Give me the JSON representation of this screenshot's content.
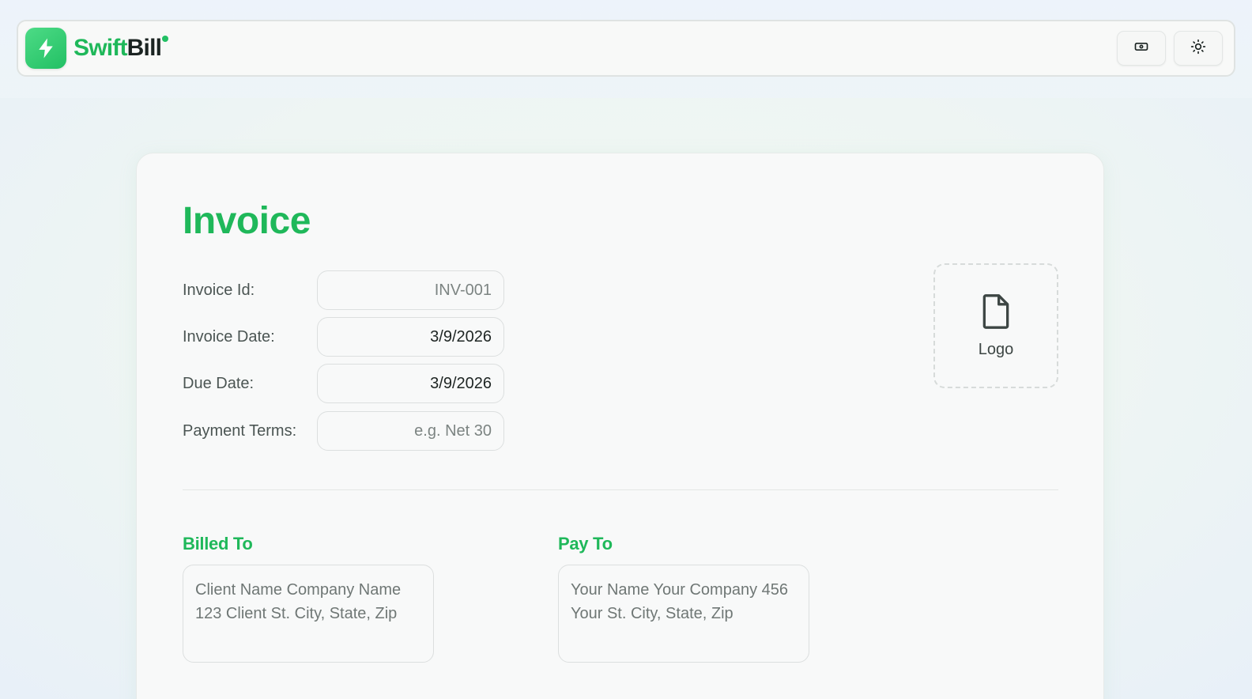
{
  "brand": {
    "name_part1": "Swift",
    "name_part2": "Bill"
  },
  "header": {
    "actions": [
      {
        "icon": "currency-icon"
      },
      {
        "icon": "sun-icon"
      }
    ]
  },
  "invoice": {
    "title": "Invoice",
    "fields": {
      "id": {
        "label": "Invoice Id:",
        "value": "",
        "placeholder": "INV-001"
      },
      "date": {
        "label": "Invoice Date:",
        "value": "3/9/2026",
        "placeholder": ""
      },
      "due": {
        "label": "Due Date:",
        "value": "3/9/2026",
        "placeholder": ""
      },
      "terms": {
        "label": "Payment Terms:",
        "value": "",
        "placeholder": "e.g. Net 30"
      }
    },
    "logo": {
      "label": "Logo",
      "icon": "file-icon"
    },
    "billed_to": {
      "title": "Billed To",
      "value": "",
      "placeholder": "Client Name Company Name 123 Client St. City, State, Zip"
    },
    "pay_to": {
      "title": "Pay To",
      "value": "",
      "placeholder": "Your Name Your Company 456 Your St. City, State, Zip"
    }
  },
  "colors": {
    "accent": "#1fb85a",
    "text": "#1b2422"
  }
}
